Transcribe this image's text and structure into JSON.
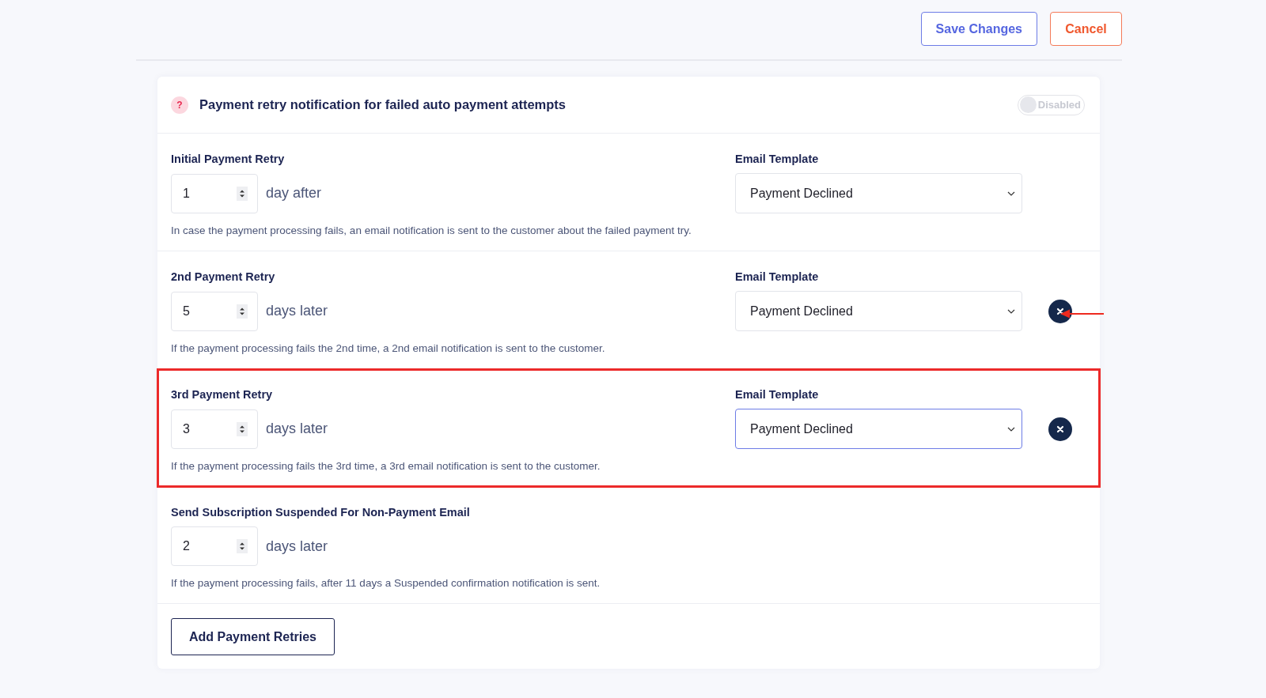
{
  "actions": [
    {
      "label": "Save Changes",
      "kind": "primary"
    },
    {
      "label": "Cancel",
      "kind": "danger"
    }
  ],
  "card": {
    "help_icon": "?",
    "title": "Payment retry notification for failed auto payment attempts",
    "toggle": {
      "label": "Disabled",
      "on": false
    },
    "rows": [
      {
        "kind": "retry",
        "label": "Initial Payment Retry",
        "value": "1",
        "unit": "day after",
        "template_label": "Email Template",
        "template": "Payment Declined",
        "focused": false,
        "removable": false,
        "highlighted": false,
        "pointed": false,
        "description": "In case the payment processing fails, an email notification is sent to the customer about the failed payment try."
      },
      {
        "kind": "retry",
        "label": "2nd Payment Retry",
        "value": "5",
        "unit": "days later",
        "template_label": "Email Template",
        "template": "Payment Declined",
        "focused": false,
        "removable": true,
        "highlighted": false,
        "pointed": true,
        "description": "If the payment processing fails the 2nd time, a 2nd email notification is sent to the customer."
      },
      {
        "kind": "retry",
        "label": "3rd Payment Retry",
        "value": "3",
        "unit": "days later",
        "template_label": "Email Template",
        "template": "Payment Declined",
        "focused": true,
        "removable": true,
        "highlighted": true,
        "pointed": false,
        "description": "If the payment processing fails the 3rd time, a 3rd email notification is sent to the customer."
      },
      {
        "kind": "suspend",
        "label": "Send Subscription Suspended For Non-Payment Email",
        "value": "2",
        "unit": "days later",
        "removable": false,
        "highlighted": false,
        "pointed": false,
        "description": "If the payment processing fails, after 11 days a Suspended confirmation notification is sent."
      }
    ],
    "add_button": "Add Payment Retries"
  }
}
